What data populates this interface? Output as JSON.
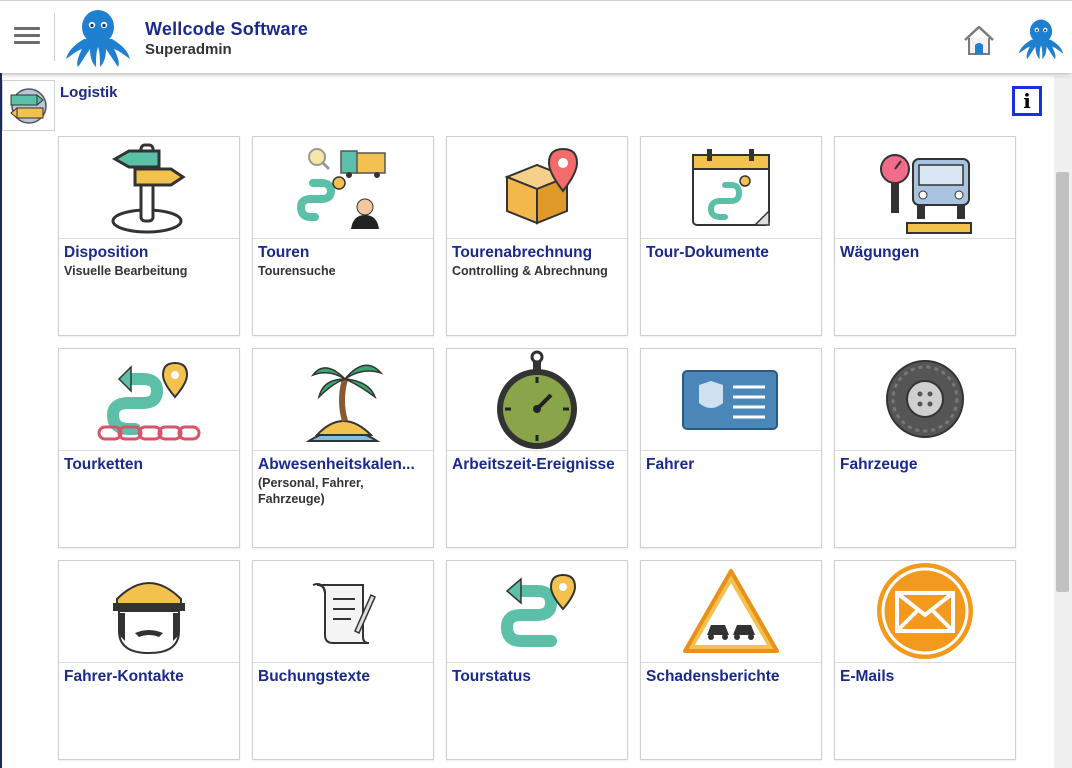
{
  "header": {
    "company": "Wellcode Software",
    "role": "Superadmin",
    "menu_icon": "hamburger-menu-icon",
    "home_icon": "home-icon",
    "logo_icon": "octopus-logo"
  },
  "module": {
    "title": "Logistik",
    "icon": "signpost-icon",
    "info_icon": "info-icon"
  },
  "colors": {
    "brand_blue": "#1a2a8c",
    "info_border": "#1430e0",
    "octopus": "#1f7fd0"
  },
  "tiles": [
    {
      "title": "Disposition",
      "subtitle": "Visuelle Bearbeitung",
      "icon": "signpost-icon"
    },
    {
      "title": "Touren",
      "subtitle": "Tourensuche",
      "icon": "truck-route-icon"
    },
    {
      "title": "Tourenabrechnung",
      "subtitle": "Controlling & Abrechnung",
      "icon": "package-location-icon"
    },
    {
      "title": "Tour-Dokumente",
      "subtitle": "",
      "icon": "calendar-route-icon"
    },
    {
      "title": "Wägungen",
      "subtitle": "",
      "icon": "truck-scale-icon"
    },
    {
      "title": "Tourketten",
      "subtitle": "",
      "icon": "route-chain-icon"
    },
    {
      "title": "Abwesenheitskalen...",
      "subtitle": "(Personal, Fahrer, Fahrzeuge)",
      "icon": "palm-island-icon"
    },
    {
      "title": "Arbeitszeit-Ereignisse",
      "subtitle": "",
      "icon": "stopwatch-icon"
    },
    {
      "title": "Fahrer",
      "subtitle": "",
      "icon": "id-card-icon"
    },
    {
      "title": "Fahrzeuge",
      "subtitle": "",
      "icon": "tire-icon"
    },
    {
      "title": "Fahrer-Kontakte",
      "subtitle": "",
      "icon": "driver-cap-icon"
    },
    {
      "title": "Buchungstexte",
      "subtitle": "",
      "icon": "scroll-document-icon"
    },
    {
      "title": "Tourstatus",
      "subtitle": "",
      "icon": "route-pin-icon"
    },
    {
      "title": "Schadensberichte",
      "subtitle": "",
      "icon": "accident-warning-icon"
    },
    {
      "title": "E-Mails",
      "subtitle": "",
      "icon": "envelope-icon"
    }
  ]
}
